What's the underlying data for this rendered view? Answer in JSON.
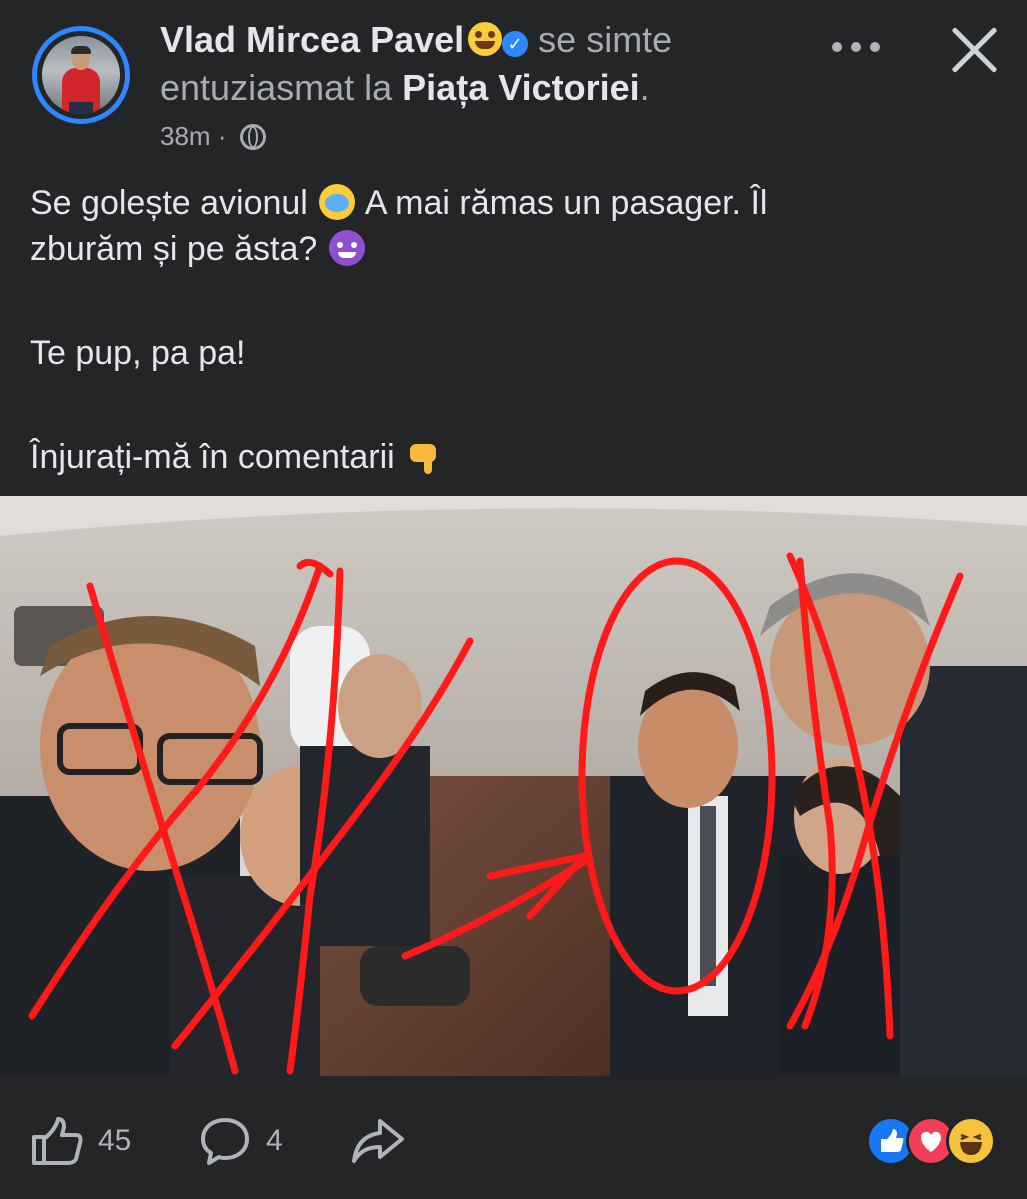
{
  "post": {
    "author": "Vlad Mircea Pavel",
    "feeling_prefix": "se simte",
    "feeling": "entuziasmat",
    "location_prefix": "la",
    "location": "Piața Victoriei",
    "location_suffix": ".",
    "time": "38m",
    "separator": "·",
    "audience_icon": "globe-icon",
    "text": {
      "line1_a": "Se golește avionul",
      "line1_b": "A mai rămas un pasager. Îl",
      "line2": "zburăm și pe ăsta?",
      "line3": "Te pup, pa pa!",
      "line4": "Înjurați-mă în comentarii"
    },
    "emojis": [
      "star-struck-emoji",
      "crying-face-emoji",
      "smiling-devil-emoji",
      "pointing-down-emoji"
    ]
  },
  "photo": {
    "description_icon": "airplane-cabin-photo",
    "annotation_color": "#ff1a1a"
  },
  "actions": {
    "like_count": "45",
    "comment_count": "4",
    "share_icon": "share-arrow-icon",
    "reactions": [
      "like-reaction-icon",
      "love-reaction-icon",
      "haha-reaction-icon"
    ]
  },
  "colors": {
    "background": "#242526",
    "primary_text": "#e4e6eb",
    "secondary_text": "#a8abaf",
    "accent": "#2d88ff"
  }
}
